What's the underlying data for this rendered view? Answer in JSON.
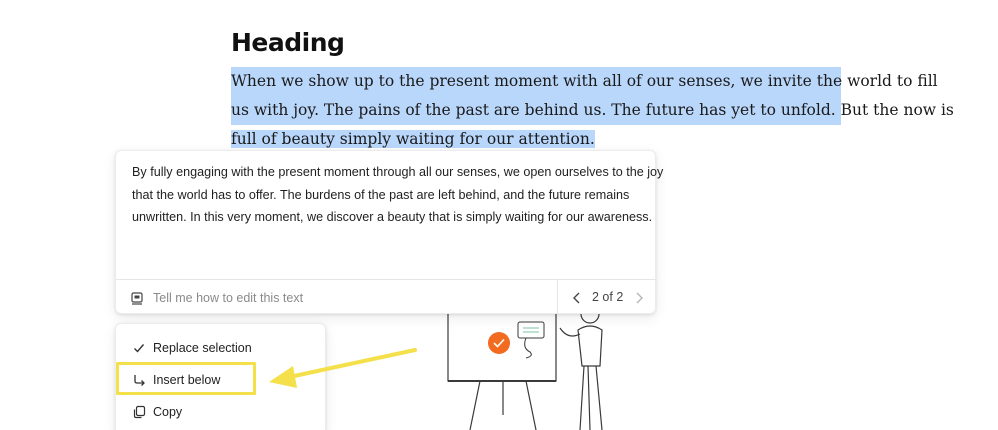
{
  "document": {
    "heading": "Heading",
    "paragraph_lines": [
      "When we show up to the present moment with all of our senses, we invite the world to fill",
      "us with joy. The pains of the past are behind us. The future has yet to unfold. But the now is",
      "full of beauty simply waiting for our attention."
    ],
    "selection_color": "#b9d6fb"
  },
  "ai_panel": {
    "suggestion_lines": [
      "By fully engaging with the present moment through all our senses, we open ourselves to the joy",
      "that the world has to offer. The burdens of the past are left behind, and the future remains",
      "unwritten. In this very moment, we discover a beauty that is simply waiting for our awareness."
    ],
    "prompt_placeholder": "Tell me how to edit this text",
    "prompt_icon": "ai-prompt-icon",
    "pager": {
      "label": "2 of 2",
      "prev_icon": "chevron-left-icon",
      "next_icon": "chevron-right-icon"
    }
  },
  "menu": {
    "items": [
      {
        "label": "Replace selection",
        "icon": "check-icon"
      },
      {
        "label": "Insert below",
        "icon": "insert-below-icon"
      },
      {
        "label": "Copy",
        "icon": "copy-icon"
      }
    ]
  },
  "annotation": {
    "highlight_color": "#f4e04a",
    "arrow_color": "#f4e04a"
  },
  "illustration": {
    "badge_color": "#f26b21",
    "accent_color": "#2d8fd8"
  }
}
